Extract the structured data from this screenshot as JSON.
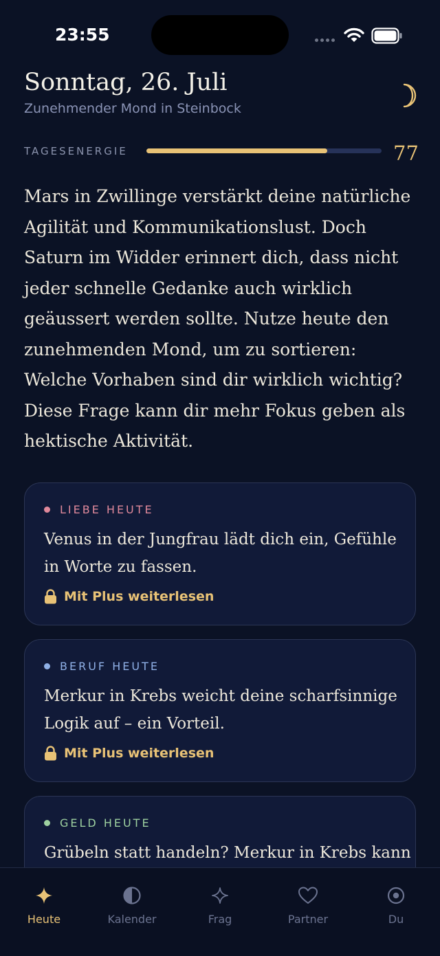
{
  "status_bar": {
    "time": "23:55"
  },
  "header": {
    "date": "Sonntag, 26. Juli",
    "moon_phase": "Zunehmender Mond in Steinbock",
    "icon": "crescent-moon-icon"
  },
  "energy": {
    "label": "TAGESENERGIE",
    "value": "77",
    "progress_percent": 77
  },
  "horoscope": {
    "text": "Mars in Zwillinge verstärkt deine natürliche Agilität und Kommunikationslust. Doch Saturn im Widder erinnert dich, dass nicht jeder schnelle Gedanke auch wirklich geäussert werden sollte. Nutze heute den zunehmenden Mond, um zu sortieren: Welche Vorhaben sind dir wirklich wichtig? Diese Frage kann dir mehr Fokus geben als hektische Aktivität."
  },
  "cards": [
    {
      "title": "LIEBE HEUTE",
      "dot_color": "#e0899b",
      "title_color": "#e0899b",
      "text": "Venus in der Jungfrau lädt dich ein, Gefühle in Worte zu fassen.",
      "link": "Mit Plus weiterlesen"
    },
    {
      "title": "BERUF HEUTE",
      "dot_color": "#8fb0e6",
      "title_color": "#8fb0e6",
      "text": "Merkur in Krebs weicht deine scharfsinnige Logik auf – ein Vorteil.",
      "link": "Mit Plus weiterlesen"
    },
    {
      "title": "GELD HEUTE",
      "dot_color": "#9ed1a0",
      "title_color": "#9ed1a0",
      "text": "Grübeln statt handeln? Merkur in Krebs kann",
      "link": ""
    }
  ],
  "tabs": [
    {
      "label": "Heute",
      "icon": "sparkle-icon",
      "active": true
    },
    {
      "label": "Kalender",
      "icon": "half-moon-icon",
      "active": false
    },
    {
      "label": "Frag",
      "icon": "star-outline-icon",
      "active": false
    },
    {
      "label": "Partner",
      "icon": "heart-icon",
      "active": false
    },
    {
      "label": "Du",
      "icon": "target-circle-icon",
      "active": false
    }
  ],
  "colors": {
    "background": "#0b1225",
    "accent": "#e8c276",
    "card_background": "#111a38",
    "muted": "#6b7390"
  }
}
